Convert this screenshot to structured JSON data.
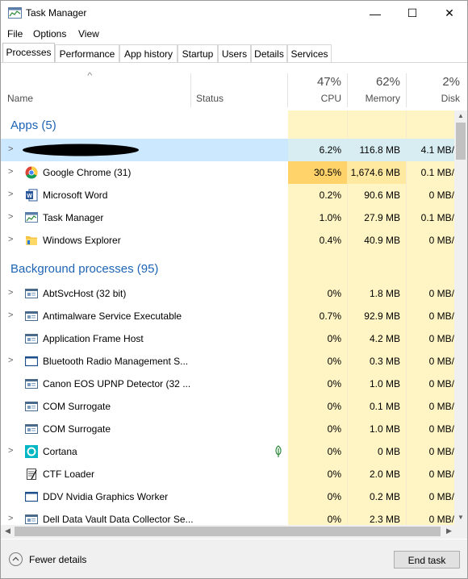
{
  "window": {
    "title": "Task Manager",
    "minimize": "—",
    "maximize": "☐",
    "close": "✕"
  },
  "menu": [
    "File",
    "Options",
    "View"
  ],
  "tabs": [
    "Processes",
    "Performance",
    "App history",
    "Startup",
    "Users",
    "Details",
    "Services"
  ],
  "header": {
    "name": "Name",
    "status": "Status",
    "cpu_pct": "47%",
    "cpu": "CPU",
    "mem_pct": "62%",
    "mem": "Memory",
    "disk_pct": "2%",
    "disk": "Disk"
  },
  "groups": {
    "apps": "Apps (5)",
    "background": "Background processes (95)"
  },
  "rows": [
    {
      "name": "",
      "cpu": "6.2%",
      "mem": "116.8 MB",
      "disk": "4.1 MB/",
      "icon": "redacted-app-icon"
    },
    {
      "name": "Google Chrome (31)",
      "cpu": "30.5%",
      "mem": "1,674.6 MB",
      "disk": "0.1 MB/",
      "icon": "chrome-icon"
    },
    {
      "name": "Microsoft Word",
      "cpu": "0.2%",
      "mem": "90.6 MB",
      "disk": "0 MB/",
      "icon": "word-icon"
    },
    {
      "name": "Task Manager",
      "cpu": "1.0%",
      "mem": "27.9 MB",
      "disk": "0.1 MB/",
      "icon": "task-manager-icon"
    },
    {
      "name": "Windows Explorer",
      "cpu": "0.4%",
      "mem": "40.9 MB",
      "disk": "0 MB/",
      "icon": "folder-icon"
    },
    {
      "name": "AbtSvcHost (32 bit)",
      "cpu": "0%",
      "mem": "1.8 MB",
      "disk": "0 MB/",
      "icon": "service-icon"
    },
    {
      "name": "Antimalware Service Executable",
      "cpu": "0.7%",
      "mem": "92.9 MB",
      "disk": "0 MB/",
      "icon": "service-icon"
    },
    {
      "name": "Application Frame Host",
      "cpu": "0%",
      "mem": "4.2 MB",
      "disk": "0 MB/",
      "icon": "service-icon"
    },
    {
      "name": "Bluetooth Radio Management S...",
      "cpu": "0%",
      "mem": "0.3 MB",
      "disk": "0 MB/",
      "icon": "window-icon"
    },
    {
      "name": "Canon EOS UPNP Detector (32 ...",
      "cpu": "0%",
      "mem": "1.0 MB",
      "disk": "0 MB/",
      "icon": "service-icon"
    },
    {
      "name": "COM Surrogate",
      "cpu": "0%",
      "mem": "0.1 MB",
      "disk": "0 MB/",
      "icon": "service-icon"
    },
    {
      "name": "COM Surrogate",
      "cpu": "0%",
      "mem": "1.0 MB",
      "disk": "0 MB/",
      "icon": "service-icon"
    },
    {
      "name": "Cortana",
      "cpu": "0%",
      "mem": "0 MB",
      "disk": "0 MB/",
      "icon": "cortana-icon"
    },
    {
      "name": "CTF Loader",
      "cpu": "0%",
      "mem": "2.0 MB",
      "disk": "0 MB/",
      "icon": "ctf-loader-icon"
    },
    {
      "name": "DDV Nvidia Graphics Worker",
      "cpu": "0%",
      "mem": "0.2 MB",
      "disk": "0 MB/",
      "icon": "window-icon"
    },
    {
      "name": "Dell Data Vault Data Collector Se...",
      "cpu": "0%",
      "mem": "2.3 MB",
      "disk": "0 MB/",
      "icon": "service-icon"
    }
  ],
  "footer": {
    "fewer_details": "Fewer details",
    "end_task": "End task"
  }
}
